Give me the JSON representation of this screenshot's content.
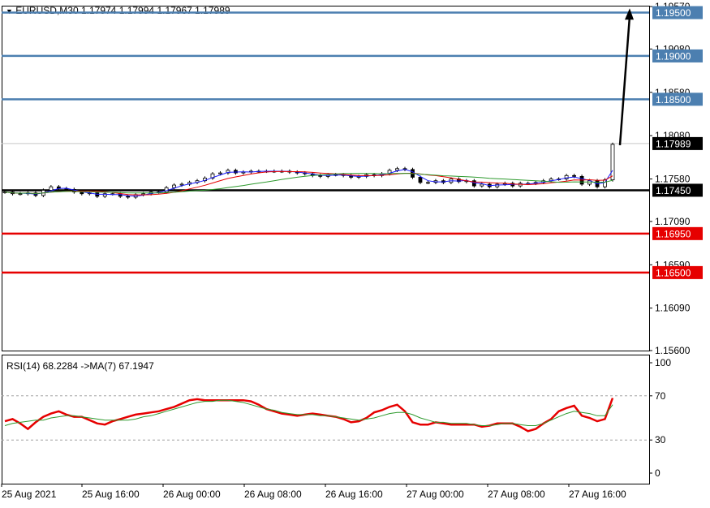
{
  "header": {
    "triangle": "▼",
    "symbol_timeframe": "EURUSD,M30",
    "ohlc": [
      "1.17974",
      "1.17994",
      "1.17967",
      "1.17989"
    ]
  },
  "chart_data": [
    {
      "type": "line",
      "title": "EURUSD,M30",
      "ylim": [
        1.156,
        1.1958
      ],
      "y_ticks": [
        "1.19570",
        "1.19080",
        "1.18580",
        "1.18080",
        "1.17580",
        "1.17090",
        "1.16590",
        "1.16090",
        "1.15600"
      ],
      "x_ticks": [
        "25 Aug 2021",
        "25 Aug 16:00",
        "26 Aug 00:00",
        "26 Aug 08:00",
        "26 Aug 16:00",
        "27 Aug 00:00",
        "27 Aug 08:00",
        "27 Aug 16:00"
      ],
      "x": [
        0,
        2,
        4,
        6,
        8,
        10,
        12,
        14,
        16,
        18,
        20,
        22,
        24,
        26,
        28,
        30,
        32,
        34,
        36,
        38,
        40,
        42,
        44,
        46,
        48,
        50,
        52,
        54,
        56,
        58,
        60,
        62,
        64,
        66,
        68,
        70,
        72,
        74,
        76,
        78,
        80,
        82,
        84,
        86,
        88,
        90,
        92,
        94,
        96,
        98,
        100,
        102,
        104,
        106,
        108,
        110,
        112,
        114,
        116,
        118,
        120,
        122,
        124,
        126,
        128,
        130,
        132,
        134,
        136,
        138,
        140,
        142,
        144,
        146,
        148,
        150,
        152,
        154,
        156,
        158
      ],
      "close_approx": [
        1.1743,
        1.1741,
        1.1741,
        1.1742,
        1.1739,
        1.1745,
        1.1749,
        1.1747,
        1.1746,
        1.1743,
        1.1741,
        1.1742,
        1.1738,
        1.1741,
        1.1741,
        1.1738,
        1.1737,
        1.174,
        1.1741,
        1.1743,
        1.1743,
        1.1748,
        1.1751,
        1.1752,
        1.1754,
        1.1756,
        1.1759,
        1.1764,
        1.1765,
        1.1768,
        1.1765,
        1.1766,
        1.1767,
        1.1767,
        1.1767,
        1.1767,
        1.1767,
        1.1766,
        1.1765,
        1.1764,
        1.1762,
        1.1761,
        1.1763,
        1.1763,
        1.1762,
        1.176,
        1.1761,
        1.1763,
        1.1762,
        1.1764,
        1.1768,
        1.177,
        1.1769,
        1.176,
        1.1754,
        1.1754,
        1.1756,
        1.1754,
        1.1758,
        1.1755,
        1.1756,
        1.175,
        1.1752,
        1.1749,
        1.1752,
        1.1753,
        1.175,
        1.1753,
        1.1753,
        1.1754,
        1.1756,
        1.1758,
        1.1758,
        1.1762,
        1.1761,
        1.1752,
        1.1756,
        1.1749,
        1.1757,
        1.1798
      ],
      "levels": [
        {
          "label": "1.19500",
          "value": 1.195,
          "color": "#4c7fb0"
        },
        {
          "label": "1.19000",
          "value": 1.19,
          "color": "#4c7fb0"
        },
        {
          "label": "1.18500",
          "value": 1.185,
          "color": "#4c7fb0"
        },
        {
          "label": "1.17989",
          "value": 1.17989,
          "color": "#000000"
        },
        {
          "label": "1.17450",
          "value": 1.1745,
          "color": "#000000"
        },
        {
          "label": "1.16950",
          "value": 1.1695,
          "color": "#e60000"
        },
        {
          "label": "1.16500",
          "value": 1.165,
          "color": "#e60000"
        }
      ],
      "arrow": {
        "from_value": 1.1797,
        "to_value": 1.1955
      }
    },
    {
      "type": "line",
      "title": "RSI(14) 68.2284  ->MA(7) 67.1947",
      "ylim": [
        0,
        100
      ],
      "y_ticks": [
        "100",
        "70",
        "30",
        "0"
      ],
      "series": [
        {
          "name": "RSI(14)",
          "color": "#e60000",
          "values": [
            47,
            49,
            45,
            40,
            46,
            51,
            54,
            56,
            53,
            51,
            51,
            48,
            45,
            44,
            47,
            49,
            51,
            53,
            54,
            55,
            56,
            58,
            60,
            63,
            66,
            67,
            66,
            66,
            66,
            66,
            66,
            66,
            65,
            62,
            58,
            56,
            54,
            53,
            52,
            53,
            54,
            53,
            52,
            51,
            49,
            46,
            47,
            50,
            55,
            57,
            60,
            62,
            56,
            46,
            44,
            44,
            46,
            45,
            44,
            44,
            44,
            44,
            42,
            43,
            45,
            45,
            45,
            42,
            38,
            40,
            45,
            49,
            56,
            59,
            61,
            52,
            50,
            47,
            49,
            68
          ]
        },
        {
          "name": "MA(7)",
          "color": "#2e9a2e",
          "values": [
            43,
            45,
            46,
            47,
            48,
            48,
            50,
            51,
            52,
            52,
            51,
            50,
            49,
            48,
            48,
            48,
            48,
            49,
            51,
            52,
            54,
            56,
            58,
            60,
            62,
            64,
            65,
            65,
            66,
            66,
            65,
            64,
            62,
            60,
            58,
            57,
            55,
            54,
            53,
            53,
            53,
            52,
            52,
            51,
            50,
            49,
            48,
            49,
            50,
            52,
            54,
            55,
            55,
            53,
            50,
            48,
            46,
            46,
            45,
            45,
            45,
            44,
            43,
            43,
            44,
            45,
            45,
            44,
            43,
            43,
            45,
            48,
            51,
            54,
            56,
            55,
            54,
            52,
            52,
            62
          ]
        }
      ]
    }
  ]
}
